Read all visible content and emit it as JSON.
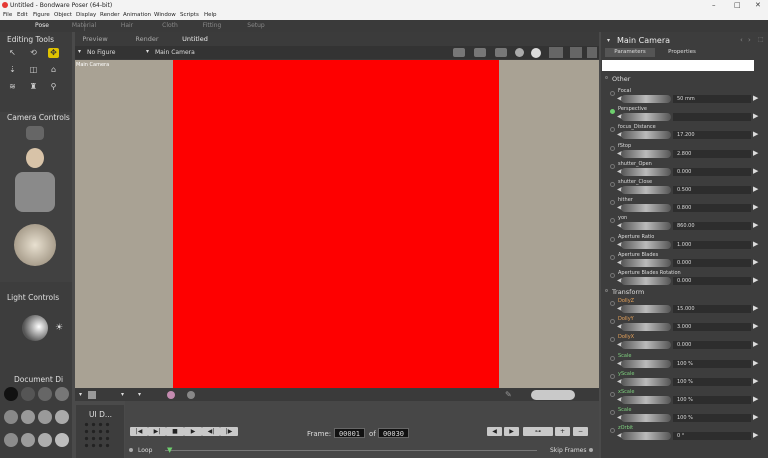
{
  "window": {
    "title": "Untitled - Bondware Poser (64-bit)"
  },
  "menu": [
    "File",
    "Edit",
    "Figure",
    "Object",
    "Display",
    "Render",
    "Animation",
    "Window",
    "Scripts",
    "Help"
  ],
  "rooms": [
    "Pose",
    "Material",
    "Hair",
    "Cloth",
    "Fitting",
    "Setup"
  ],
  "left": {
    "editing_tools": "Editing Tools",
    "camera_controls": "Camera Controls",
    "light_controls": "Light Controls",
    "document_display": "Document  Di",
    "ui_dots": "UI D..."
  },
  "viewport": {
    "tabs": [
      "Preview",
      "Render",
      "Untitled"
    ],
    "figure_select": "No Figure",
    "camera_select": "Main Camera",
    "label": "Main Camera"
  },
  "anim": {
    "frame_label": "Frame:",
    "frame_current": "00001",
    "of_label": "of",
    "frame_total": "00030",
    "loop_label": "Loop",
    "skip_label": "Skip Frames"
  },
  "params": {
    "title": "Main Camera",
    "tabs": [
      "Parameters",
      "Properties"
    ],
    "search_value": "",
    "section_other": "Other",
    "section_transform": "Transform",
    "rows": [
      {
        "label": "Focal",
        "value": "50 mm",
        "style": "",
        "dot": false
      },
      {
        "label": "Perspective",
        "value": "",
        "style": "",
        "dot": true
      },
      {
        "label": "focus_Distance",
        "value": "17.200",
        "style": "",
        "dot": false
      },
      {
        "label": "fStop",
        "value": "2.800",
        "style": "",
        "dot": false
      },
      {
        "label": "shutter_Open",
        "value": "0.000",
        "style": "",
        "dot": false
      },
      {
        "label": "shutter_Close",
        "value": "0.500",
        "style": "",
        "dot": false
      },
      {
        "label": "hither",
        "value": "0.800",
        "style": "",
        "dot": false
      },
      {
        "label": "yon",
        "value": "860.00",
        "style": "",
        "dot": false
      },
      {
        "label": "Aperture Ratio",
        "value": "1.000",
        "style": "",
        "dot": false
      },
      {
        "label": "Aperture Blades",
        "value": "0.000",
        "style": "",
        "dot": false
      },
      {
        "label": "Aperture Blades Rotation",
        "value": "0.000",
        "style": "",
        "dot": false
      }
    ],
    "transform_rows": [
      {
        "label": "DollyZ",
        "value": "15.000",
        "style": "o"
      },
      {
        "label": "DollyY",
        "value": "3.000",
        "style": "o"
      },
      {
        "label": "DollyX",
        "value": "0.000",
        "style": "o"
      },
      {
        "label": "Scale",
        "value": "100 %",
        "style": "g"
      },
      {
        "label": "yScale",
        "value": "100 %",
        "style": "g"
      },
      {
        "label": "xScale",
        "value": "100 %",
        "style": "g"
      },
      {
        "label": "Scale",
        "value": "100 %",
        "style": "g"
      },
      {
        "label": "zOrbit",
        "value": "0 °",
        "style": "g"
      }
    ]
  }
}
